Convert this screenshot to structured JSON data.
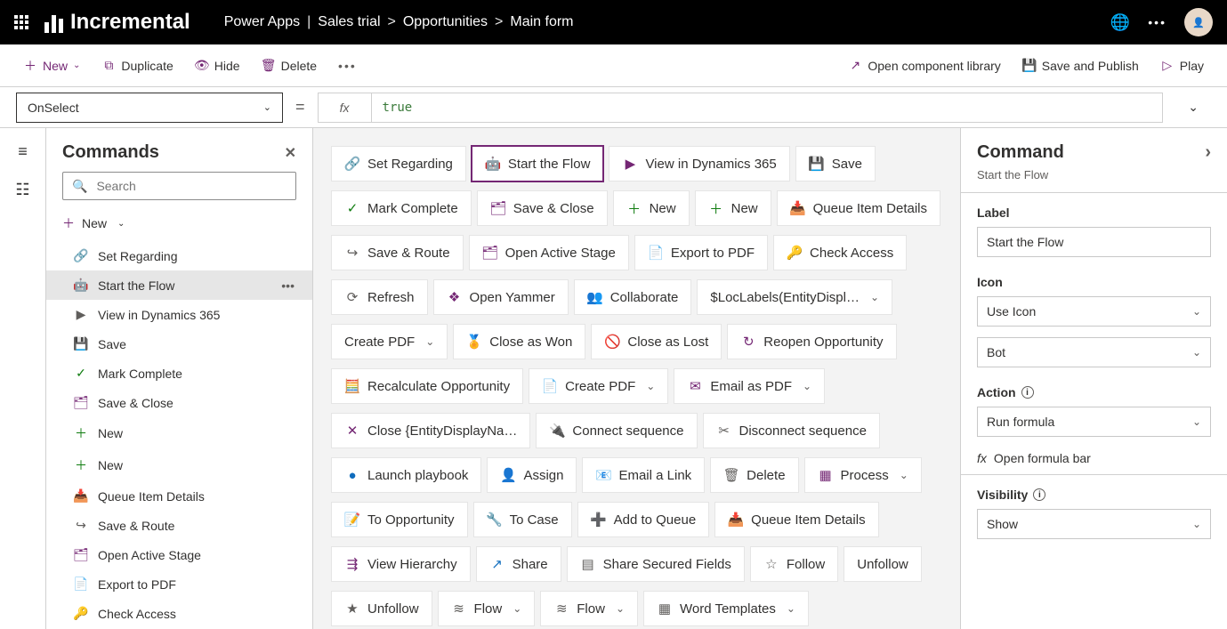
{
  "brand": "Incremental",
  "breadcrumb": {
    "app": "Power Apps",
    "sep1": "|",
    "trial": "Sales trial",
    "arrow": ">",
    "entity": "Opportunities",
    "form": "Main form"
  },
  "toolbar": {
    "new": "New",
    "duplicate": "Duplicate",
    "hide": "Hide",
    "delete": "Delete",
    "open_lib": "Open component library",
    "save_publish": "Save and Publish",
    "play": "Play"
  },
  "formula": {
    "property": "OnSelect",
    "value": "true",
    "fx": "fx"
  },
  "left": {
    "title": "Commands",
    "search_placeholder": "Search",
    "new": "New",
    "items": [
      "Set Regarding",
      "Start the Flow",
      "View in Dynamics 365",
      "Save",
      "Mark Complete",
      "Save & Close",
      "New",
      "New",
      "Queue Item Details",
      "Save & Route",
      "Open Active Stage",
      "Export to PDF",
      "Check Access"
    ],
    "selected_index": 1
  },
  "canvas_rows": [
    [
      {
        "label": "Set Regarding",
        "icon": "link",
        "cls": "c-accent"
      },
      {
        "label": "Start the Flow",
        "icon": "bot",
        "cls": "c-accent",
        "selected": true
      },
      {
        "label": "View in Dynamics 365",
        "icon": "play",
        "cls": "c-accent"
      },
      {
        "label": "Save",
        "icon": "save",
        "cls": "c-accent"
      }
    ],
    [
      {
        "label": "Mark Complete",
        "icon": "check",
        "cls": "c-green"
      },
      {
        "label": "Save & Close",
        "icon": "saveclose",
        "cls": "c-accent"
      },
      {
        "label": "New",
        "icon": "plus",
        "cls": "c-green"
      },
      {
        "label": "New",
        "icon": "plus",
        "cls": "c-green"
      },
      {
        "label": "Queue Item Details",
        "icon": "queue",
        "cls": "c-accent"
      }
    ],
    [
      {
        "label": "Save & Route",
        "icon": "route",
        "cls": "c-gray"
      },
      {
        "label": "Open Active Stage",
        "icon": "stage",
        "cls": "c-accent"
      },
      {
        "label": "Export to PDF",
        "icon": "pdf",
        "cls": "c-accent"
      },
      {
        "label": "Check Access",
        "icon": "key",
        "cls": "c-gray"
      }
    ],
    [
      {
        "label": "Refresh",
        "icon": "refresh",
        "cls": "c-gray"
      },
      {
        "label": "Open Yammer",
        "icon": "yammer",
        "cls": "c-accent"
      },
      {
        "label": "Collaborate",
        "icon": "teams",
        "cls": "c-accent"
      },
      {
        "label": "$LocLabels(EntityDispl…",
        "icon": "",
        "cls": "c-gray",
        "dd": true
      }
    ],
    [
      {
        "label": "Create PDF",
        "icon": "",
        "cls": "c-gray",
        "dd": true
      },
      {
        "label": "Close as Won",
        "icon": "medal",
        "cls": "c-blue"
      },
      {
        "label": "Close as Lost",
        "icon": "no",
        "cls": "c-red"
      },
      {
        "label": "Reopen Opportunity",
        "icon": "reopen",
        "cls": "c-accent"
      }
    ],
    [
      {
        "label": "Recalculate Opportunity",
        "icon": "calc",
        "cls": "c-accent"
      },
      {
        "label": "Create PDF",
        "icon": "pdf",
        "cls": "c-accent",
        "dd": true
      },
      {
        "label": "Email as PDF",
        "icon": "mail",
        "cls": "c-accent",
        "dd": true
      }
    ],
    [
      {
        "label": "Close {EntityDisplayNa…",
        "icon": "x",
        "cls": "c-accent"
      },
      {
        "label": "Connect sequence",
        "icon": "connect",
        "cls": "c-gray"
      },
      {
        "label": "Disconnect sequence",
        "icon": "disconnect",
        "cls": "c-gray"
      }
    ],
    [
      {
        "label": "Launch playbook",
        "icon": "dot-blue",
        "cls": "c-blue"
      },
      {
        "label": "Assign",
        "icon": "assign",
        "cls": "c-gray"
      },
      {
        "label": "Email a Link",
        "icon": "maillink",
        "cls": "c-gray"
      },
      {
        "label": "Delete",
        "icon": "trash",
        "cls": "c-gray"
      },
      {
        "label": "Process",
        "icon": "process",
        "cls": "c-accent",
        "dd": true
      }
    ],
    [
      {
        "label": "To Opportunity",
        "icon": "note",
        "cls": "c-accent"
      },
      {
        "label": "To Case",
        "icon": "wrench",
        "cls": "c-gray"
      },
      {
        "label": "Add to Queue",
        "icon": "addq",
        "cls": "c-gray"
      },
      {
        "label": "Queue Item Details",
        "icon": "queue",
        "cls": "c-accent"
      }
    ],
    [
      {
        "label": "View Hierarchy",
        "icon": "hier",
        "cls": "c-accent"
      },
      {
        "label": "Share",
        "icon": "share",
        "cls": "c-blue"
      },
      {
        "label": "Share Secured Fields",
        "icon": "form",
        "cls": "c-gray"
      },
      {
        "label": "Follow",
        "icon": "star",
        "cls": "c-gray"
      },
      {
        "label": "Unfollow",
        "icon": "",
        "cls": "c-gray"
      }
    ],
    [
      {
        "label": "Unfollow",
        "icon": "starx",
        "cls": "c-gray"
      },
      {
        "label": "Flow",
        "icon": "flow",
        "cls": "c-gray",
        "dd": true
      },
      {
        "label": "Flow",
        "icon": "flow",
        "cls": "c-gray",
        "dd": true
      },
      {
        "label": "Word Templates",
        "icon": "word",
        "cls": "c-gray",
        "dd": true
      }
    ]
  ],
  "right": {
    "title": "Command",
    "subtitle": "Start the Flow",
    "label_label": "Label",
    "label_value": "Start the Flow",
    "icon_label": "Icon",
    "icon_select": "Use Icon",
    "icon_value": "Bot",
    "action_label": "Action",
    "action_value": "Run formula",
    "open_formula": "Open formula bar",
    "visibility_label": "Visibility",
    "visibility_value": "Show"
  }
}
